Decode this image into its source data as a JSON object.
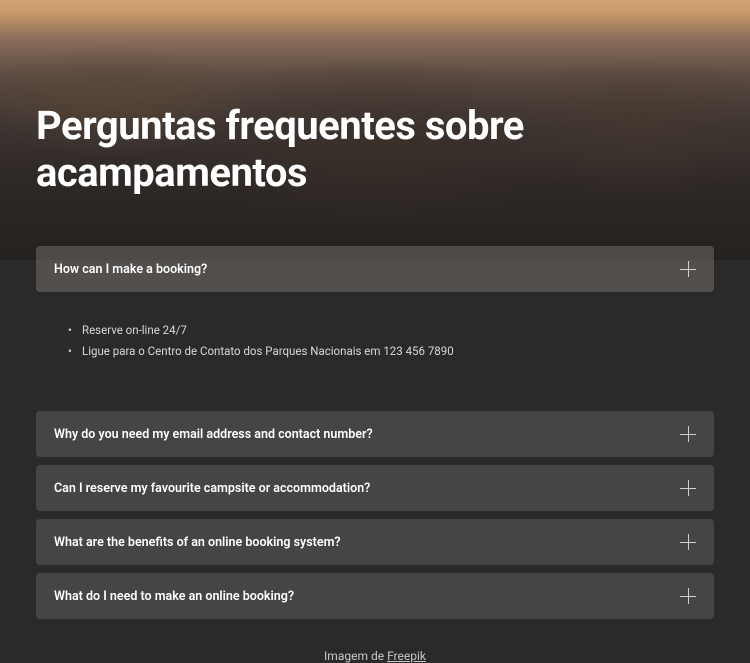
{
  "title": "Perguntas frequentes sobre acampamentos",
  "faq": {
    "items": [
      {
        "question": "How can I make a booking?",
        "bullets": [
          "Reserve on-line 24/7",
          "Ligue para o Centro de Contato dos Parques Nacionais em 123 456 7890"
        ]
      },
      {
        "question": "Why do you need my email address and contact number?"
      },
      {
        "question": "Can I reserve my favourite campsite or accommodation?"
      },
      {
        "question": "What are the benefits of an online booking system?"
      },
      {
        "question": "What do I need to make an online booking?"
      }
    ]
  },
  "attribution": {
    "prefix": "Imagem de ",
    "linkText": "Freepik"
  }
}
